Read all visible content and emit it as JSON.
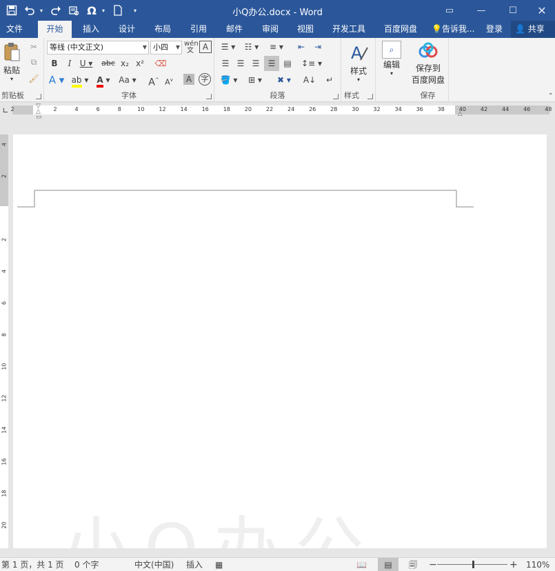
{
  "titlebar": {
    "title": "小Q办公.docx - Word"
  },
  "tabs": [
    "文件",
    "开始",
    "插入",
    "设计",
    "布局",
    "引用",
    "邮件",
    "审阅",
    "视图",
    "开发工具",
    "百度网盘"
  ],
  "tellme": "告诉我...",
  "login": "登录",
  "share": "共享",
  "ribbon": {
    "clipboard": {
      "label": "剪贴板",
      "paste": "粘贴"
    },
    "font": {
      "label": "字体",
      "font_name": "等线 (中文正文)",
      "font_size": "小四"
    },
    "paragraph": {
      "label": "段落"
    },
    "styles": {
      "label": "样式",
      "styles_btn": "样式"
    },
    "editing": {
      "edit_btn": "编辑"
    },
    "save": {
      "label": "保存",
      "save_btn_line1": "保存到",
      "save_btn_line2": "百度网盘"
    }
  },
  "ruler": {
    "h_left": "2",
    "h_numbers": [
      "2",
      "4",
      "6",
      "8",
      "10",
      "12",
      "14",
      "16",
      "18",
      "20",
      "22",
      "24",
      "26",
      "28",
      "30",
      "32",
      "34",
      "36",
      "38",
      "40",
      "42",
      "44",
      "46",
      "48"
    ],
    "v_numbers": [
      "4",
      "2",
      "",
      "2",
      "4",
      "6",
      "8",
      "10",
      "12",
      "14",
      "16",
      "18",
      "20"
    ]
  },
  "watermark": "小Q办公",
  "status": {
    "page": "第 1 页，共 1 页",
    "words": "0 个字",
    "lang": "中文(中国)",
    "mode": "插入",
    "zoom": "110%"
  }
}
